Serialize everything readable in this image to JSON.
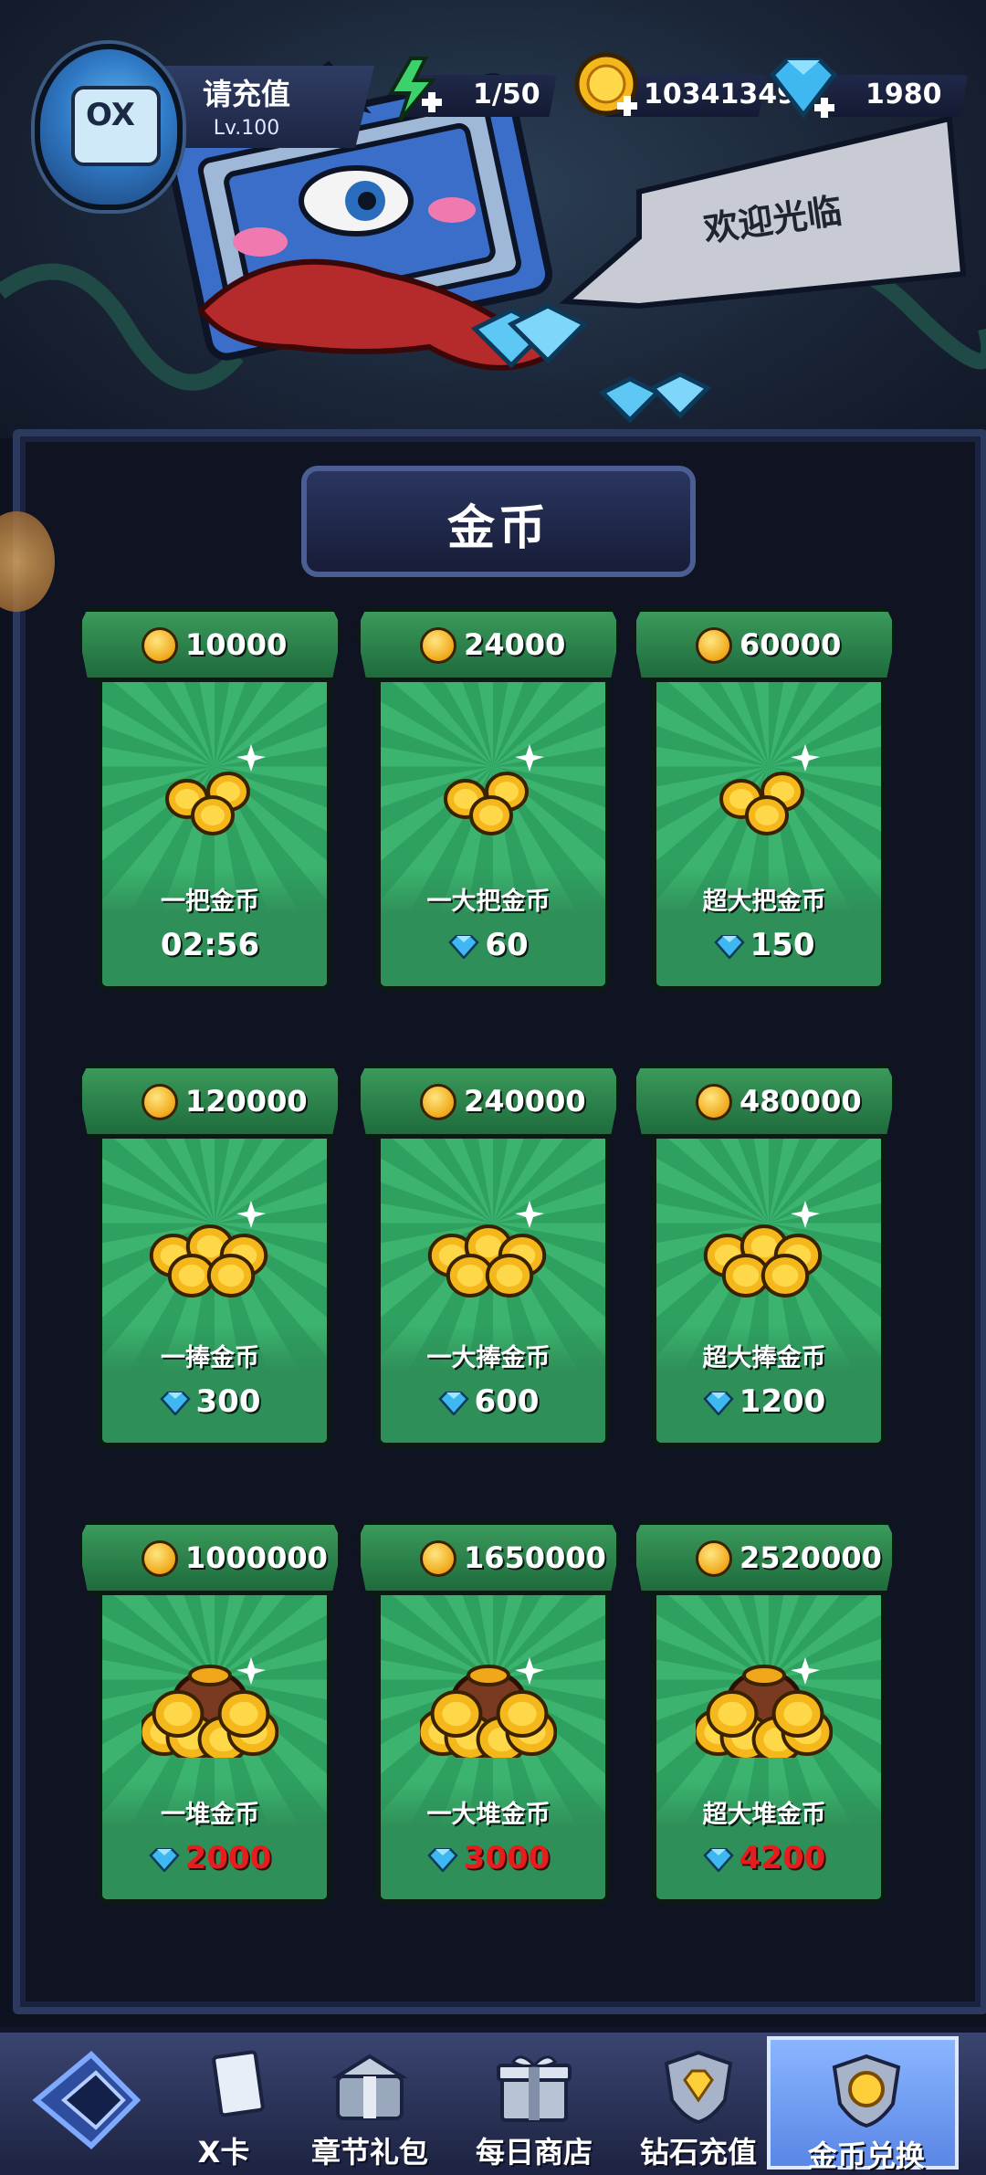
{
  "header": {
    "player_name": "请充值",
    "player_level": "Lv.100",
    "energy": "1/50",
    "gold": "10341349",
    "diamonds": "1980"
  },
  "banner": {
    "greeting": "欢迎光临"
  },
  "shop": {
    "title": "金币",
    "items": [
      {
        "amount": "10000",
        "label": "一把金币",
        "price": "02:56",
        "price_type": "timer"
      },
      {
        "amount": "24000",
        "label": "一大把金币",
        "price": "60",
        "price_type": "gem"
      },
      {
        "amount": "60000",
        "label": "超大把金币",
        "price": "150",
        "price_type": "gem"
      },
      {
        "amount": "120000",
        "label": "一捧金币",
        "price": "300",
        "price_type": "gem"
      },
      {
        "amount": "240000",
        "label": "一大捧金币",
        "price": "600",
        "price_type": "gem"
      },
      {
        "amount": "480000",
        "label": "超大捧金币",
        "price": "1200",
        "price_type": "gem"
      },
      {
        "amount": "1000000",
        "label": "一堆金币",
        "price": "2000",
        "price_type": "gem-red"
      },
      {
        "amount": "1650000",
        "label": "一大堆金币",
        "price": "3000",
        "price_type": "gem-red"
      },
      {
        "amount": "2520000",
        "label": "超大堆金币",
        "price": "4200",
        "price_type": "gem-red"
      }
    ]
  },
  "nav": {
    "items": [
      {
        "label": "X卡",
        "icon": "card-icon"
      },
      {
        "label": "章节礼包",
        "icon": "gift-chest-icon"
      },
      {
        "label": "每日商店",
        "icon": "gift-box-icon"
      },
      {
        "label": "钻石充值",
        "icon": "diamond-shield-icon"
      },
      {
        "label": "金币兑换",
        "icon": "gold-shield-icon",
        "active": true
      }
    ]
  },
  "colors": {
    "card_green": "#2ea060",
    "price_red": "#e51d1d",
    "nav_active": "#8ab6ff"
  }
}
